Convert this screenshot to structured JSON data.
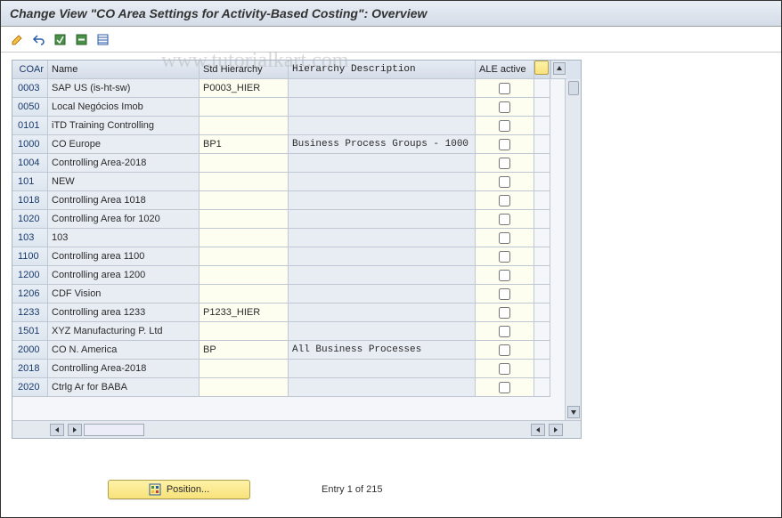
{
  "title": "Change View \"CO Area Settings for Activity-Based Costing\": Overview",
  "watermark": "www.tutorialkart.com",
  "columns": {
    "coar": "COAr",
    "name": "Name",
    "stdh": "Std Hierarchy",
    "hdesc": "Hierarchy Description",
    "ale": "ALE active"
  },
  "rows": [
    {
      "coar": "0003",
      "name": "SAP US (is-ht-sw)",
      "stdh": "P0003_HIER",
      "hdesc": "",
      "ale": false
    },
    {
      "coar": "0050",
      "name": "Local Negócios Imob",
      "stdh": "",
      "hdesc": "",
      "ale": false
    },
    {
      "coar": "0101",
      "name": "iTD Training Controlling",
      "stdh": "",
      "hdesc": "",
      "ale": false
    },
    {
      "coar": "1000",
      "name": "CO Europe",
      "stdh": "BP1",
      "hdesc": "Business Process Groups - 1000",
      "ale": false
    },
    {
      "coar": "1004",
      "name": "Controlling Area-2018",
      "stdh": "",
      "hdesc": "",
      "ale": false
    },
    {
      "coar": "101",
      "name": "NEW",
      "stdh": "",
      "hdesc": "",
      "ale": false
    },
    {
      "coar": "1018",
      "name": "Controlling Area 1018",
      "stdh": "",
      "hdesc": "",
      "ale": false
    },
    {
      "coar": "1020",
      "name": "Controlling Area for 1020",
      "stdh": "",
      "hdesc": "",
      "ale": false
    },
    {
      "coar": "103",
      "name": "103",
      "stdh": "",
      "hdesc": "",
      "ale": false
    },
    {
      "coar": "1100",
      "name": "Controlling area 1100",
      "stdh": "",
      "hdesc": "",
      "ale": false
    },
    {
      "coar": "1200",
      "name": "Controlling area 1200",
      "stdh": "",
      "hdesc": "",
      "ale": false
    },
    {
      "coar": "1206",
      "name": "CDF Vision",
      "stdh": "",
      "hdesc": "",
      "ale": false
    },
    {
      "coar": "1233",
      "name": "Controlling area 1233",
      "stdh": "P1233_HIER",
      "hdesc": "",
      "ale": false
    },
    {
      "coar": "1501",
      "name": "XYZ Manufacturing P. Ltd",
      "stdh": "",
      "hdesc": "",
      "ale": false
    },
    {
      "coar": "2000",
      "name": "CO N. America",
      "stdh": "BP",
      "hdesc": "All Business Processes",
      "ale": false
    },
    {
      "coar": "2018",
      "name": "Controlling Area-2018",
      "stdh": "",
      "hdesc": "",
      "ale": false
    },
    {
      "coar": "2020",
      "name": "Ctrlg Ar for BABA",
      "stdh": "",
      "hdesc": "",
      "ale": false
    }
  ],
  "position_button": "Position...",
  "entry_text": "Entry 1 of 215"
}
